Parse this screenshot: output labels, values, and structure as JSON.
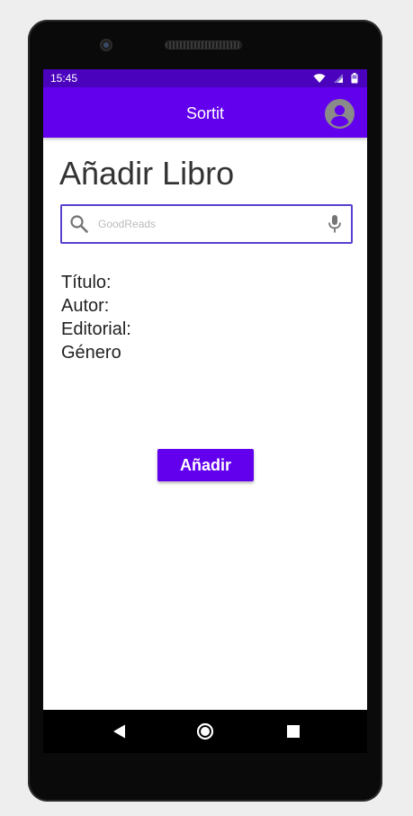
{
  "status_bar": {
    "time": "15:45",
    "icons": [
      "wifi-icon",
      "signal-icon",
      "battery-icon"
    ]
  },
  "app_bar": {
    "title": "Sortit",
    "avatar_icon": "account-circle-icon"
  },
  "page": {
    "heading": "Añadir Libro"
  },
  "search": {
    "placeholder": "GoodReads",
    "value": "",
    "leading_icon": "search-icon",
    "trailing_icon": "mic-icon"
  },
  "book_info": {
    "title_label": "Título:",
    "author_label": "Autor:",
    "publisher_label": "Editorial:",
    "genre_label": "Género"
  },
  "actions": {
    "add_label": "Añadir"
  },
  "nav_bar": {
    "buttons": [
      "back-icon",
      "home-icon",
      "recents-icon"
    ]
  },
  "colors": {
    "primary": "#6200ee",
    "status_bar": "#4a02bd",
    "search_border": "#5a3fd0"
  }
}
